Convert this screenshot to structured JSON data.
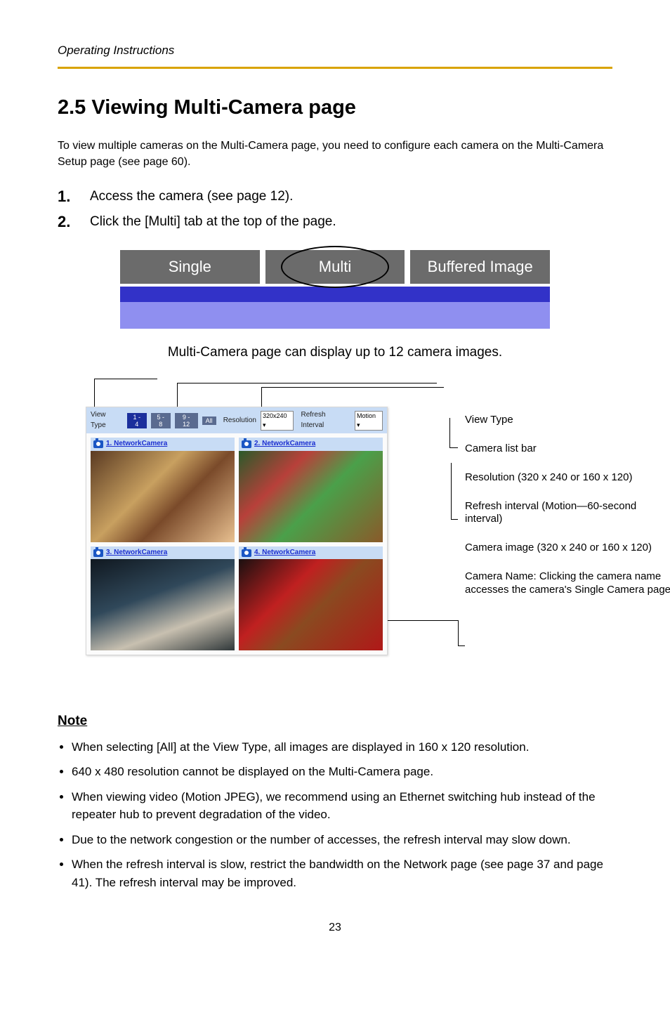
{
  "header": {
    "left_text": "Operating Instructions",
    "right_text": ""
  },
  "section": {
    "number_title": "2.5 Viewing Multi-Camera page"
  },
  "intro": "To view multiple cameras on the Multi-Camera page, you need to configure each camera on the Multi-Camera Setup page (see page 60).",
  "steps": [
    {
      "num": "1.",
      "text": "Access the camera (see page 12)."
    },
    {
      "num": "2.",
      "text": "Click the [Multi] tab at the top of the page."
    }
  ],
  "tabs": {
    "single": "Single",
    "multi": "Multi",
    "buffered": "Buffered Image"
  },
  "multi_caption": "Multi-Camera page can display up to 12 camera images.",
  "panel": {
    "view_type_label": "View Type",
    "buttons": [
      "1 - 4",
      "5 - 8",
      "9 - 12",
      "All"
    ],
    "resolution_label": "Resolution",
    "resolution_value": "320x240",
    "refresh_label": "Refresh Interval",
    "refresh_value": "Motion",
    "cells": [
      {
        "link": "1. NetworkCamera"
      },
      {
        "link": "2. NetworkCamera"
      },
      {
        "link": "3. NetworkCamera"
      },
      {
        "link": "4. NetworkCamera"
      }
    ]
  },
  "callouts": {
    "view_type": "View Type",
    "camera_list_bar": "Camera list bar",
    "resolution": "Resolution (320 x 240 or 160 x 120)",
    "refresh_interval": "Refresh interval (Motion—60-second interval)",
    "camera_image": "Camera image (320 x 240 or 160 x 120)",
    "camera_name": "Camera Name: Clicking the camera name accesses the camera's Single Camera page."
  },
  "notes": {
    "heading": "Note",
    "items": [
      "When selecting [All] at the View Type, all images are displayed in 160 x 120 resolution.",
      "640 x 480 resolution cannot be displayed on the Multi-Camera page.",
      "When viewing video (Motion JPEG), we recommend using an Ethernet switching hub instead of the repeater hub to prevent degradation of the video.",
      "Due to the network congestion or the number of accesses, the refresh interval may slow down.",
      "When the refresh interval is slow, restrict the bandwidth on the Network page (see page 37 and page 41). The refresh interval may be improved."
    ]
  },
  "footer": {
    "page_number": "23"
  }
}
